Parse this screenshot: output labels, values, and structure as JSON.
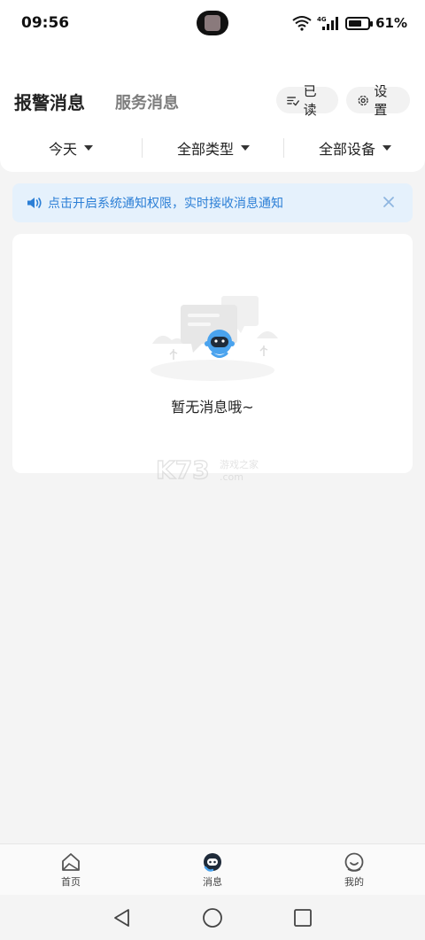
{
  "status_bar": {
    "time": "09:56",
    "network": "4G",
    "battery": "61%"
  },
  "header": {
    "tab_active": "报警消息",
    "tab_inactive": "服务消息",
    "read_button": "已读",
    "settings_button": "设置"
  },
  "filters": {
    "date": "今天",
    "type": "全部类型",
    "device": "全部设备"
  },
  "notice": {
    "text": "点击开启系统通知权限，实时接收消息通知"
  },
  "empty_state": {
    "text": "暂无消息哦~"
  },
  "watermark": {
    "text": "K73 游戏之家 .com"
  },
  "bottom_nav": {
    "home": "首页",
    "messages": "消息",
    "mine": "我的"
  },
  "colors": {
    "accent": "#2c7fd6",
    "notice_bg": "#e5f1fc",
    "mascot": "#4aa3ee"
  }
}
